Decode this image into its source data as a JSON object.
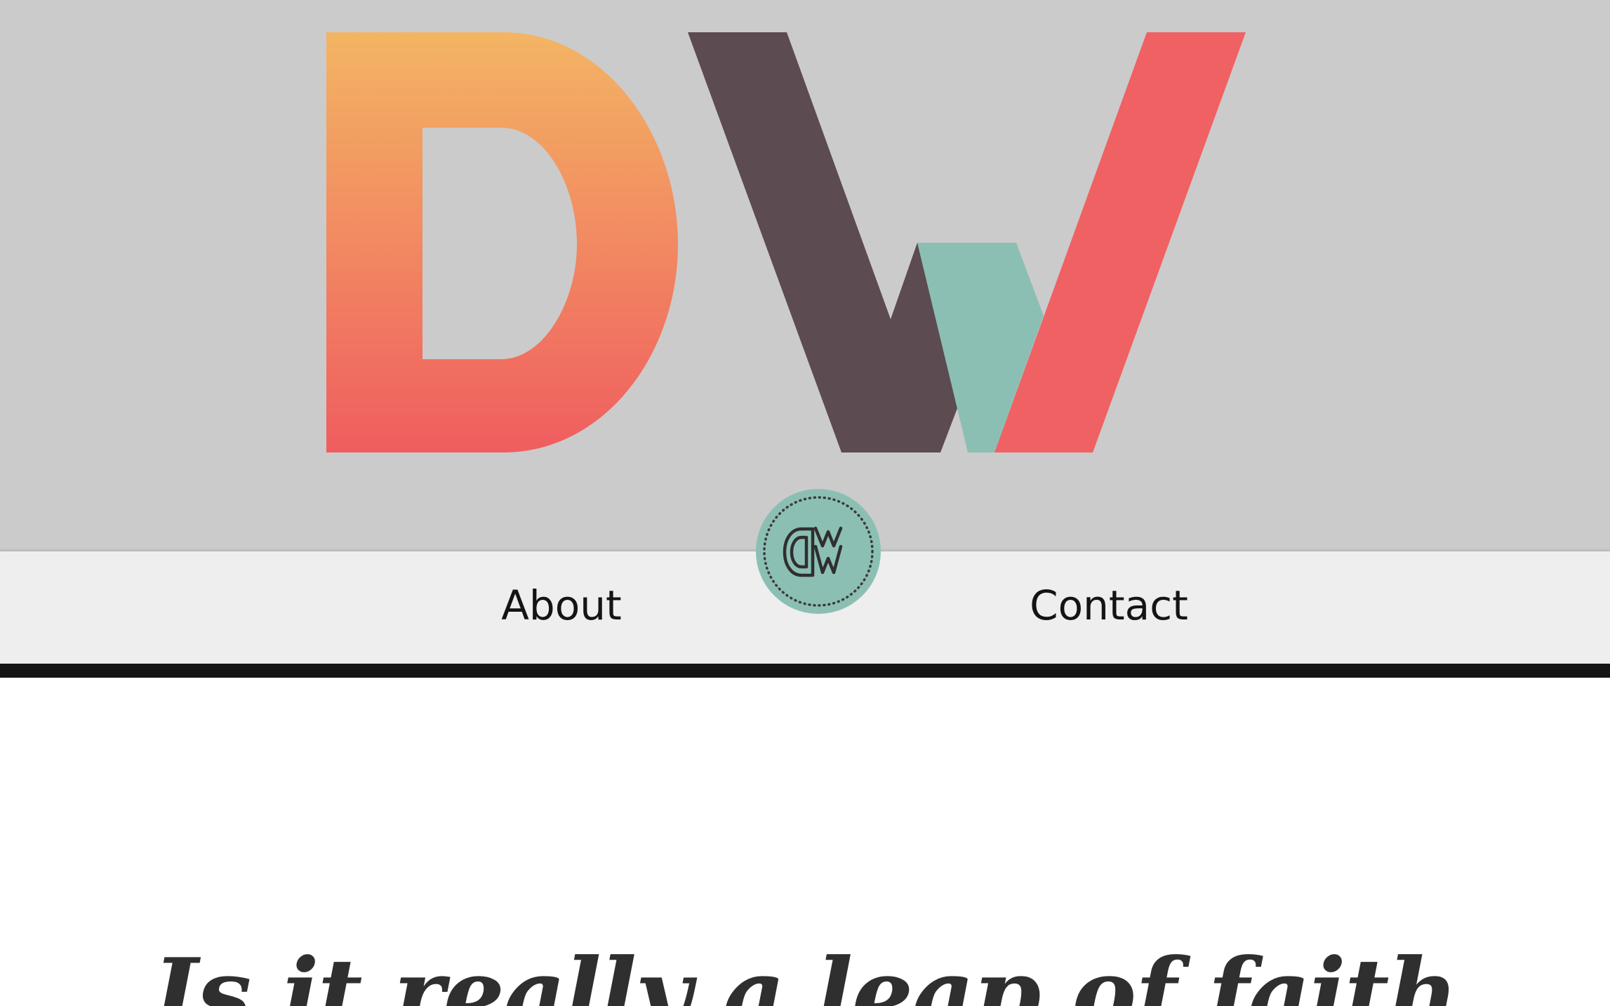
{
  "header": {
    "logo_name": "dw-monogram-logo",
    "colors": {
      "background": "#cbcbcb",
      "d_gradient_top": "#f3b563",
      "d_gradient_bottom": "#f05d60",
      "w_dark": "#5c4b51",
      "w_teal": "#8cbfb3",
      "w_coral": "#f06163"
    }
  },
  "nav": {
    "items": [
      {
        "label": "About"
      },
      {
        "label": "Contact"
      }
    ],
    "badge": {
      "icon": "dw-badge-icon",
      "color": "#8cbfb3"
    },
    "background": "#eeeeee",
    "rule_color": "#151515"
  },
  "main": {
    "headline": "Is it really a leap of faith"
  }
}
